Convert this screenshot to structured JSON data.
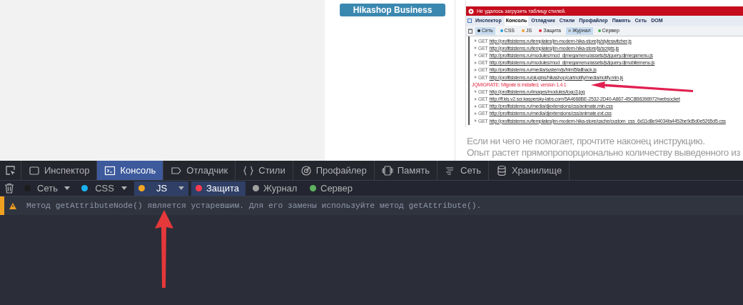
{
  "page": {
    "sidebar_button": "Hikashop Business",
    "embedded_screenshot": {
      "error_bar": "Не удалось загрузить таблицу стилей.",
      "tabs": [
        {
          "label": "Инспектор",
          "selected": false
        },
        {
          "label": "Консоль",
          "selected": true
        },
        {
          "label": "Отладчик",
          "selected": false
        },
        {
          "label": "Стили",
          "selected": false
        },
        {
          "label": "Профайлер",
          "selected": false
        },
        {
          "label": "Память",
          "selected": false
        },
        {
          "label": "Сеть",
          "selected": false
        },
        {
          "label": "DOM",
          "selected": false
        }
      ],
      "filters": [
        {
          "label": "Сеть",
          "color": "#222222",
          "selected": true
        },
        {
          "label": "CSS",
          "color": "#2b9fe0",
          "selected": false
        },
        {
          "label": "JS",
          "color": "#f0a030",
          "selected": false
        },
        {
          "label": "Защита",
          "color": "#e03040",
          "selected": false
        },
        {
          "label": "Журнал",
          "color": "#9a9a9a",
          "selected": true
        },
        {
          "label": "Сервер",
          "color": "#4caf50",
          "selected": false
        }
      ],
      "log": [
        {
          "kind": "request",
          "method": "GET",
          "url": "http://profitsistems.ru/templates/jm-modern-hika-store/js/styleswitcher.js"
        },
        {
          "kind": "request",
          "method": "GET",
          "url": "http://profitsistems.ru/templates/jm-modern-hika-store/js/scripts.js"
        },
        {
          "kind": "request",
          "method": "GET",
          "url": "http://profitsistems.ru/modules/mod_djmegamenu/assets/js/jquery.djmegamenu.js"
        },
        {
          "kind": "request",
          "method": "GET",
          "url": "http://profitsistems.ru/modules/mod_djmegamenu/assets/js/jquery.djmobilemenu.js"
        },
        {
          "kind": "request",
          "method": "GET",
          "url": "http://profitsistems.ru/media/system/js/html5fallback.js"
        },
        {
          "kind": "request",
          "method": "GET",
          "url": "http://profitsistems.ru/plugins/hikashop/cartnotify/media/notify.min.js"
        },
        {
          "kind": "message",
          "text": "JQMIGRATE: Migrate is installed, version 1.4.1"
        },
        {
          "kind": "request",
          "method": "GET",
          "url": "http://profitsistems.ru/images/modules/logo3.jpg"
        },
        {
          "kind": "request",
          "method": "GET",
          "url": "http://ff.kis.v2.scr.kaspersky-labs.com/5A4668BE-2532-2D40-A867-45C8B6398972/websocket"
        },
        {
          "kind": "request",
          "method": "GET",
          "url": "http://profitsistems.ru/media/djextensions/css/animate.min.css"
        },
        {
          "kind": "request",
          "method": "GET",
          "url": "http://profitsistems.ru/media/djextensions/css/animate.ext.css"
        },
        {
          "kind": "request",
          "method": "GET",
          "url": "http://profitsistems.ru/templates/jm-modern-hika-store/cache/custom_css_6d11d8e94034fa4452be9d5d0e5265d5.css"
        }
      ]
    },
    "paragraphs": [
      "Если ни чего не помогает, прочтите наконец инструкцию.",
      "Опыт растет прямопропорционально количеству выведенного из"
    ]
  },
  "devtools": {
    "tabs": [
      {
        "label": "Инспектор",
        "selected": false
      },
      {
        "label": "Консоль",
        "selected": true
      },
      {
        "label": "Отладчик",
        "selected": false
      },
      {
        "label": "Стили",
        "selected": false
      },
      {
        "label": "Профайлер",
        "selected": false
      },
      {
        "label": "Память",
        "selected": false
      },
      {
        "label": "Сеть",
        "selected": false
      },
      {
        "label": "Хранилище",
        "selected": false
      }
    ],
    "filters": [
      {
        "label": "Сеть",
        "color": "#1c1c1c",
        "selected": false
      },
      {
        "label": "CSS",
        "color": "#1ab2ef",
        "selected": false
      },
      {
        "label": "JS",
        "color": "#f5a623",
        "selected": true
      },
      {
        "label": "Защита",
        "color": "#ff3b4e",
        "selected": true
      },
      {
        "label": "Журнал",
        "color": "#a0a0a0",
        "selected": false
      },
      {
        "label": "Сервер",
        "color": "#5fb35f",
        "selected": false
      }
    ],
    "messages": [
      {
        "kind": "warning",
        "text": "Метод getAttributeNode() является устаревшим. Для его замены используйте метод getAttribute()."
      }
    ]
  }
}
